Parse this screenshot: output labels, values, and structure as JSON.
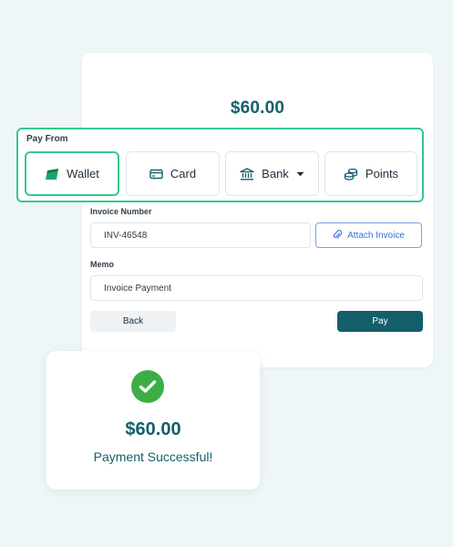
{
  "payment": {
    "amount": "$60.00"
  },
  "pay_from": {
    "label": "Pay From",
    "methods": [
      {
        "label": "Wallet",
        "icon": "wallet-icon",
        "selected": true
      },
      {
        "label": "Card",
        "icon": "card-icon",
        "selected": false
      },
      {
        "label": "Bank",
        "icon": "bank-icon",
        "selected": false
      },
      {
        "label": "Points",
        "icon": "coins-icon",
        "selected": false
      }
    ]
  },
  "invoice": {
    "label": "Invoice Number",
    "value": "INV-46548",
    "attach_label": "Attach Invoice"
  },
  "memo": {
    "label": "Memo",
    "value": "Invoice Payment"
  },
  "actions": {
    "back_label": "Back",
    "pay_label": "Pay"
  },
  "success": {
    "amount": "$60.00",
    "message": "Payment Successful!"
  },
  "colors": {
    "accent": "#135f6b",
    "selected_border": "#35c98b",
    "success": "#3dae46",
    "link": "#3a6fd8",
    "background": "#eef6f7"
  }
}
